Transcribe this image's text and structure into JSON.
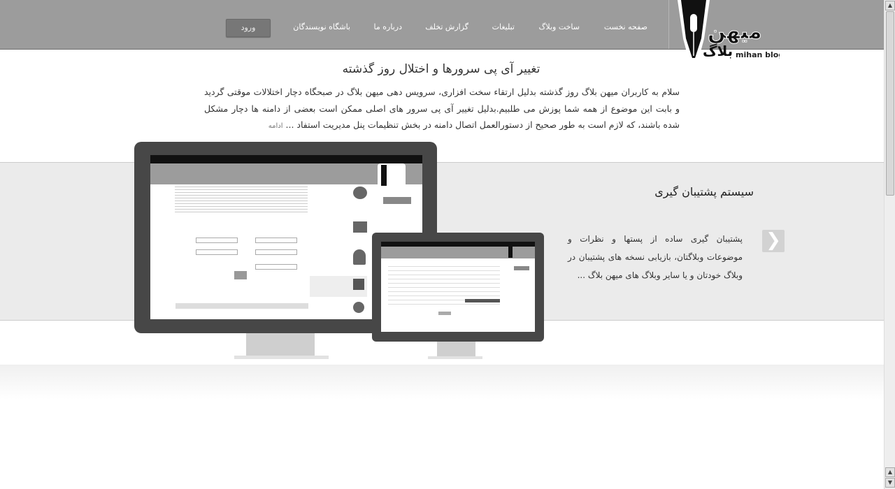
{
  "header": {
    "logo_text": "میهن بلاگ mihan blog",
    "nav": [
      "صفحه نخست",
      "ساخت وبلاگ",
      "تبلیغات",
      "گزارش تخلف",
      "درباره ما",
      "باشگاه نویسندگان"
    ],
    "login_label": "ورود"
  },
  "news": {
    "title": "تغییر آی پی سرورها و اختلال روز گذشته",
    "body": "سلام به کاربران میهن بلاگ روز گذشته بدلیل ارتقاء سخت افزاری، سرویس دهی میهن بلاگ در صبحگاه دچار اختلالات موقتی گردید و بابت این موضوع از همه شما پوزش می طلبیم.بدلیل تغییر آی پی سرور های اصلی ممکن است بعضی از دامنه ها دچار مشکل شده باشند، که لازم است به طور صحیح از دستورالعمل اتصال دامنه در بخش تنظیمات پنل مدیریت استفاد ...",
    "more_label": "ادامه"
  },
  "feature": {
    "title": "سیستم پشتیبان گیری",
    "body": "پشتیبان گیری ساده از پستها و نظرات و موضوعات وبلاگتان، بازیابی نسخه های پشتیبان در وبلاگ خودتان و یا سایر وبلاگ های میهن بلاگ ...",
    "next_icon": "chevron-right-icon"
  },
  "colors": {
    "header_bg": "#9c9c9c",
    "band_bg": "#ebebeb",
    "login_bg": "#777777"
  }
}
